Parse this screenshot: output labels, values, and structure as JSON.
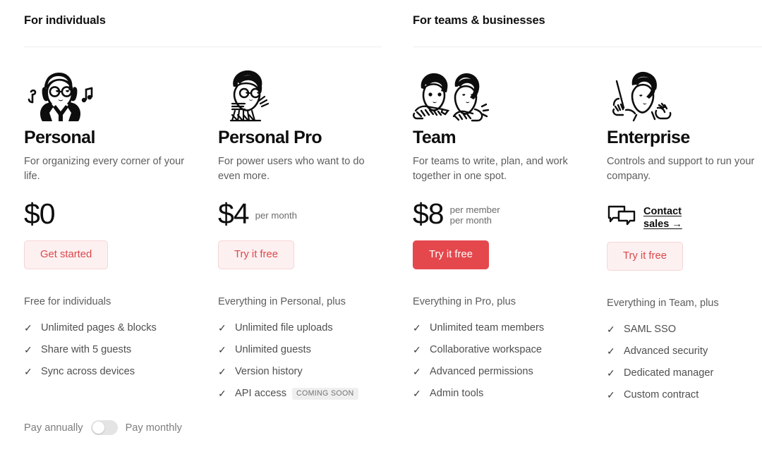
{
  "sections": [
    {
      "title": "For individuals"
    },
    {
      "title": "For teams & businesses"
    }
  ],
  "plans": [
    {
      "art": "person-headphones-illustration",
      "name": "Personal",
      "description": "For organizing every corner of your life.",
      "price": "$0",
      "price_unit": "",
      "cta_label": "Get started",
      "cta_style": "outline",
      "features_head": "Free for individuals",
      "features": [
        {
          "label": "Unlimited pages & blocks",
          "badge": ""
        },
        {
          "label": "Share with 5 guests",
          "badge": ""
        },
        {
          "label": "Sync across devices",
          "badge": ""
        }
      ]
    },
    {
      "art": "person-typing-illustration",
      "name": "Personal Pro",
      "description": "For power users who want to do even more.",
      "price": "$4",
      "price_unit": "per month",
      "cta_label": "Try it free",
      "cta_style": "outline",
      "features_head": "Everything in Personal, plus",
      "features": [
        {
          "label": "Unlimited file uploads",
          "badge": ""
        },
        {
          "label": "Unlimited guests",
          "badge": ""
        },
        {
          "label": "Version history",
          "badge": ""
        },
        {
          "label": "API access",
          "badge": "COMING SOON"
        }
      ]
    },
    {
      "art": "two-people-illustration",
      "name": "Team",
      "description": "For teams to write, plan, and work together in one spot.",
      "price": "$8",
      "price_unit": "per member\nper month",
      "cta_label": "Try it free",
      "cta_style": "solid",
      "features_head": "Everything in Pro, plus",
      "features": [
        {
          "label": "Unlimited team members",
          "badge": ""
        },
        {
          "label": "Collaborative workspace",
          "badge": ""
        },
        {
          "label": "Advanced permissions",
          "badge": ""
        },
        {
          "label": "Admin tools",
          "badge": ""
        }
      ]
    },
    {
      "art": "person-waving-illustration",
      "name": "Enterprise",
      "description": "Controls and support to run your company.",
      "contact_label": "Contact sales →",
      "cta_label": "Try it free",
      "cta_style": "outline",
      "features_head": "Everything in Team, plus",
      "features": [
        {
          "label": "SAML SSO",
          "badge": ""
        },
        {
          "label": "Advanced security",
          "badge": ""
        },
        {
          "label": "Dedicated manager",
          "badge": ""
        },
        {
          "label": "Custom contract",
          "badge": ""
        }
      ]
    }
  ],
  "billing": {
    "annual_label": "Pay annually",
    "monthly_label": "Pay monthly",
    "selected": "annually"
  },
  "icons": {
    "check": "✓"
  },
  "colors": {
    "accent": "#e4484d",
    "accent_soft_bg": "#fdf0f0",
    "accent_soft_border": "#f6d6d6",
    "text": "#111111",
    "muted": "#5d5d5d",
    "badge_bg": "#efefef"
  }
}
